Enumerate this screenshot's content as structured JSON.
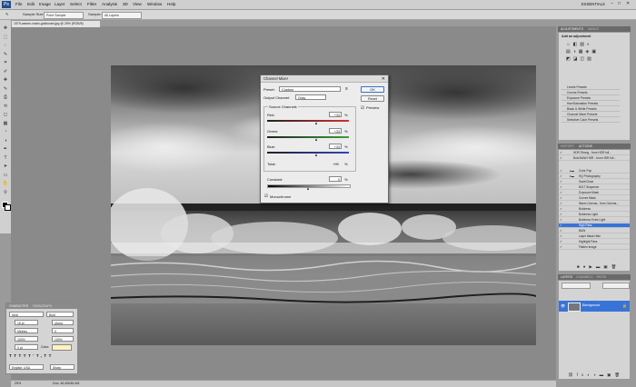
{
  "app": {
    "logo": "Ps"
  },
  "menu": {
    "items": [
      "File",
      "Edit",
      "Image",
      "Layer",
      "Select",
      "Filter",
      "Analysis",
      "3D",
      "View",
      "Window",
      "Help"
    ],
    "workspace": "ESSENTIALS",
    "window_controls": [
      "–",
      "□",
      "✕"
    ]
  },
  "options_bar": {
    "sample_size_label": "Sample Size:",
    "sample_size_value": "Point Sample",
    "sample_label": "Sample:",
    "sample_value": "All Layers"
  },
  "document": {
    "tab_title": "1579-waves-crash-goldcoast.jpg @ 25% (RGB/8)",
    "status_zoom": "25%",
    "status_doc": "Doc: 46.4M/46.4M"
  },
  "tools": [
    "move",
    "marquee",
    "lasso",
    "quick-select",
    "crop",
    "eyedropper",
    "healing",
    "brush",
    "stamp",
    "history-brush",
    "eraser",
    "gradient",
    "blur",
    "dodge",
    "pen",
    "type",
    "path-select",
    "shape",
    "hand",
    "zoom"
  ],
  "channel_mixer": {
    "title": "Channel Mixer",
    "preset_label": "Preset:",
    "preset_value": "Custom",
    "output_channel_label": "Output Channel:",
    "output_channel_value": "Gray",
    "source_channels_label": "Source Channels",
    "channels": [
      {
        "label": "Red:",
        "value": "+33",
        "unit": "%",
        "color": "#d03030"
      },
      {
        "label": "Green:",
        "value": "+33",
        "unit": "%",
        "color": "#3aa03a"
      },
      {
        "label": "Blue:",
        "value": "+33",
        "unit": "%",
        "color": "#3045c0"
      }
    ],
    "total_label": "Total:",
    "total_value": "+99",
    "total_unit": "%",
    "constant_label": "Constant:",
    "constant_value": "0",
    "constant_unit": "%",
    "monochrome_label": "Monochrome",
    "monochrome_checked": true,
    "ok_label": "OK",
    "reset_label": "Reset",
    "preview_label": "Preview",
    "preview_checked": true
  },
  "adjustments_panel": {
    "tabs": [
      "ADJUSTMENTS",
      "MASKS"
    ],
    "heading": "Add an adjustment",
    "presets": [
      "Levels Presets",
      "Curves Presets",
      "Exposure Presets",
      "Hue/Saturation Presets",
      "Black & White Presets",
      "Channel Mixer Presets",
      "Selective Color Presets"
    ]
  },
  "actions_panel": {
    "tabs": [
      "HISTORY",
      "ACTIONS"
    ],
    "rows": [
      {
        "label": "HDR Strong - from HDR full...",
        "selected": false
      },
      {
        "label": "Bold B&W HDR - from HDR full...",
        "selected": false
      },
      {
        "label": "Color Pop",
        "selected": false
      },
      {
        "label": "HQ Photography",
        "selected": false
      },
      {
        "label": "Save/Close",
        "selected": false
      },
      {
        "label": "8017 Sequence",
        "selected": false
      },
      {
        "label": "Exposure Mask",
        "selected": false
      },
      {
        "label": "Curves Mask",
        "selected": false
      },
      {
        "label": "Warm Cinema - from Cinema...",
        "selected": false
      },
      {
        "label": "Boldness",
        "selected": false
      },
      {
        "label": "Boldness Light",
        "selected": false
      },
      {
        "label": "Boldness Extra Light",
        "selected": false
      },
      {
        "label": "High Pass",
        "selected": true
      },
      {
        "label": "B&W",
        "selected": false
      },
      {
        "label": "Layer Mask Hide",
        "selected": false
      },
      {
        "label": "Highlight Pass",
        "selected": false
      },
      {
        "label": "Flatten Image",
        "selected": false
      }
    ]
  },
  "layers_panel": {
    "tabs": [
      "LAYERS",
      "CHANNELS",
      "PATHS"
    ],
    "layer_name": "Background"
  },
  "character_panel": {
    "tabs": [
      "CHARACTER",
      "PARAGRAPH"
    ],
    "font_family": "Arial",
    "font_style": "Bold",
    "size": "18 pt",
    "leading": "(Auto)",
    "kerning": "Metrics",
    "tracking": "0",
    "vscale": "100%",
    "hscale": "100%",
    "baseline": "0 pt",
    "color_label": "Color:",
    "language": "English: USA",
    "antialias": "Sharp"
  },
  "colors": {
    "selected_row": "#3874d8",
    "panel_header": "#6a6a6a"
  }
}
